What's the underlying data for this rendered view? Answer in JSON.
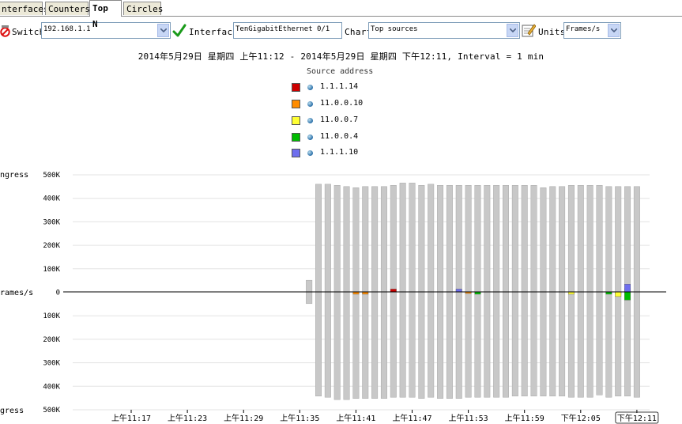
{
  "tabs": [
    {
      "label": "nterfaces",
      "active": false
    },
    {
      "label": "Counters",
      "active": false
    },
    {
      "label": "Top N",
      "active": true
    },
    {
      "label": "Circles",
      "active": false
    }
  ],
  "toolbar": {
    "switch_label": "Switch",
    "switch_value": "192.168.1.1",
    "interface_label": "Interface",
    "interface_value": "TenGigabitEthernet 0/1",
    "chart_label": "Chart",
    "chart_value": "Top sources",
    "units_label": "Units",
    "units_value": "Frames/s"
  },
  "header": {
    "range_text": "2014年5月29日 星期四 上午11:12 - 2014年5月29日 星期四 下午12:11, Interval = 1 min"
  },
  "colors": {
    "bar": "#c8c8c8",
    "bar_stroke": "#a8a8a8",
    "axis": "#000000",
    "grid": "#e3e3e3"
  },
  "chart_data": {
    "type": "bar",
    "legend_title": "Source address",
    "legend_placement": "top-center",
    "ylabel_top": "ngress",
    "ylabel_middle": "rames/s",
    "ylabel_bottom": "gress",
    "ylim": [
      -500000,
      500000
    ],
    "y_ticks": [
      "500K",
      "400K",
      "300K",
      "200K",
      "100K",
      "0",
      "100K",
      "200K",
      "300K",
      "400K",
      "500K"
    ],
    "x_ticks": [
      "上午11:17",
      "上午11:23",
      "上午11:29",
      "上午11:35",
      "上午11:41",
      "上午11:47",
      "上午11:53",
      "上午11:59",
      "下午12:05",
      "下午12:11"
    ],
    "grid": true,
    "series": [
      {
        "name": "1.1.1.14",
        "color": "#cc0000"
      },
      {
        "name": "11.0.0.10",
        "color": "#ff8c00"
      },
      {
        "name": "11.0.0.7",
        "color": "#ffff33"
      },
      {
        "name": "11.0.0.4",
        "color": "#00bb00"
      },
      {
        "name": "1.1.1.10",
        "color": "#6f6fee"
      }
    ],
    "total_ingress": [
      0,
      0,
      0,
      0,
      0,
      0,
      0,
      0,
      0,
      0,
      0,
      0,
      0,
      0,
      0,
      0,
      0,
      0,
      0,
      0,
      0,
      0,
      0,
      0,
      50000,
      460000,
      460000,
      455000,
      450000,
      445000,
      450000,
      450000,
      450000,
      455000,
      465000,
      465000,
      455000,
      460000,
      455000,
      455000,
      455000,
      455000,
      455000,
      455000,
      455000,
      455000,
      455000,
      455000,
      455000,
      445000,
      450000,
      450000,
      455000,
      455000,
      455000,
      455000,
      450000,
      450000,
      450000,
      450000
    ],
    "total_egress": [
      0,
      0,
      0,
      0,
      0,
      0,
      0,
      0,
      0,
      0,
      0,
      0,
      0,
      0,
      0,
      0,
      0,
      0,
      0,
      0,
      0,
      0,
      0,
      0,
      50000,
      445000,
      450000,
      460000,
      460000,
      455000,
      455000,
      455000,
      455000,
      450000,
      450000,
      450000,
      455000,
      450000,
      455000,
      455000,
      455000,
      450000,
      450000,
      450000,
      450000,
      450000,
      445000,
      445000,
      445000,
      445000,
      445000,
      445000,
      450000,
      450000,
      450000,
      440000,
      450000,
      445000,
      445000,
      450000
    ],
    "top_marks": [
      {
        "minute": 29,
        "series": "11.0.0.10",
        "value": -10000
      },
      {
        "minute": 30,
        "series": "11.0.0.10",
        "value": -10000
      },
      {
        "minute": 33,
        "series": "1.1.1.14",
        "value": 12000
      },
      {
        "minute": 40,
        "series": "1.1.1.10",
        "value": 12000
      },
      {
        "minute": 41,
        "series": "11.0.0.10",
        "value": -5000
      },
      {
        "minute": 42,
        "series": "11.0.0.4",
        "value": -10000
      },
      {
        "minute": 52,
        "series": "11.0.0.7",
        "value": -10000
      },
      {
        "minute": 56,
        "series": "11.0.0.4",
        "value": -10000
      },
      {
        "minute": 57,
        "series": "11.0.0.10",
        "value": -10000
      },
      {
        "minute": 57,
        "series": "11.0.0.7",
        "value": -20000
      },
      {
        "minute": 58,
        "series": "1.1.1.14",
        "value": 15000
      },
      {
        "minute": 58,
        "series": "11.0.0.4",
        "value": -35000
      },
      {
        "minute": 58,
        "series": "1.1.1.10",
        "value": 33000
      }
    ]
  }
}
